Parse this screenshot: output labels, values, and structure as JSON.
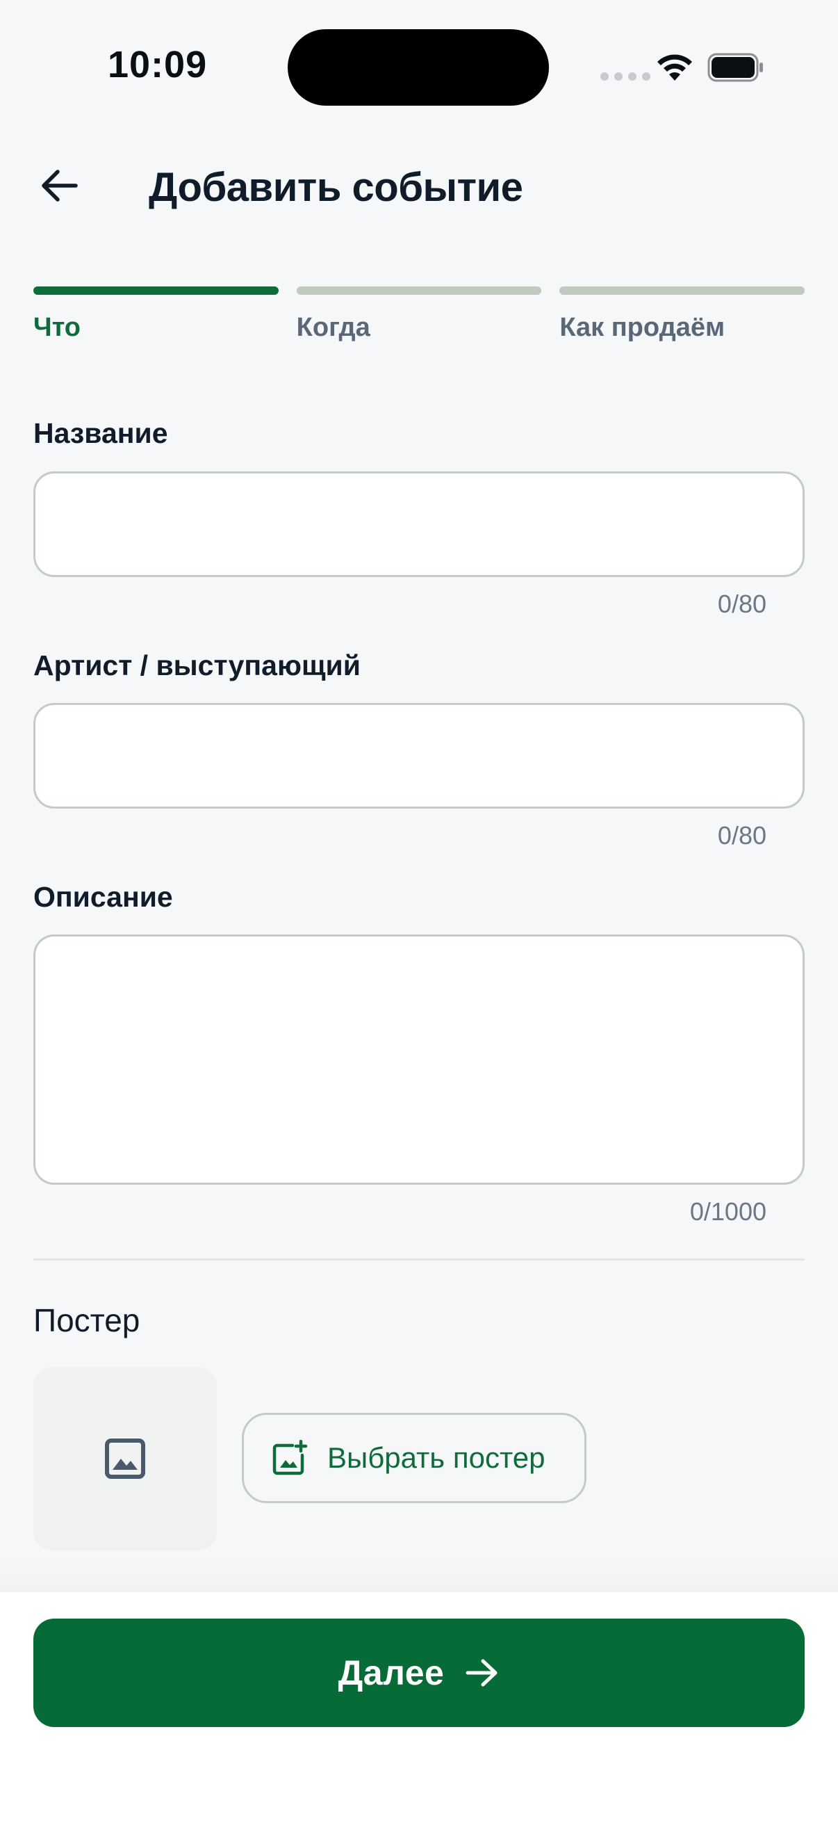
{
  "status_bar": {
    "time": "10:09"
  },
  "header": {
    "title": "Добавить событие",
    "back_icon": "arrow-left-icon"
  },
  "stepper": {
    "steps": [
      {
        "label": "Что",
        "active": true
      },
      {
        "label": "Когда",
        "active": false
      },
      {
        "label": "Как продаём",
        "active": false
      }
    ]
  },
  "form": {
    "name": {
      "label": "Название",
      "value": "",
      "counter": "0/80"
    },
    "artist": {
      "label": "Артист / выступающий",
      "value": "",
      "counter": "0/80"
    },
    "description": {
      "label": "Описание",
      "value": "",
      "counter": "0/1000"
    }
  },
  "poster": {
    "title": "Постер",
    "placeholder_icon": "image-icon",
    "button_label": "Выбрать постер",
    "button_icon": "add-photo-icon"
  },
  "footer": {
    "next_label": "Далее",
    "next_icon": "arrow-right-icon"
  },
  "colors": {
    "accent": "#0f6b3a",
    "primary_button": "#066b36",
    "inactive_step": "#c0cbbf",
    "background": "#f6f7f9"
  }
}
